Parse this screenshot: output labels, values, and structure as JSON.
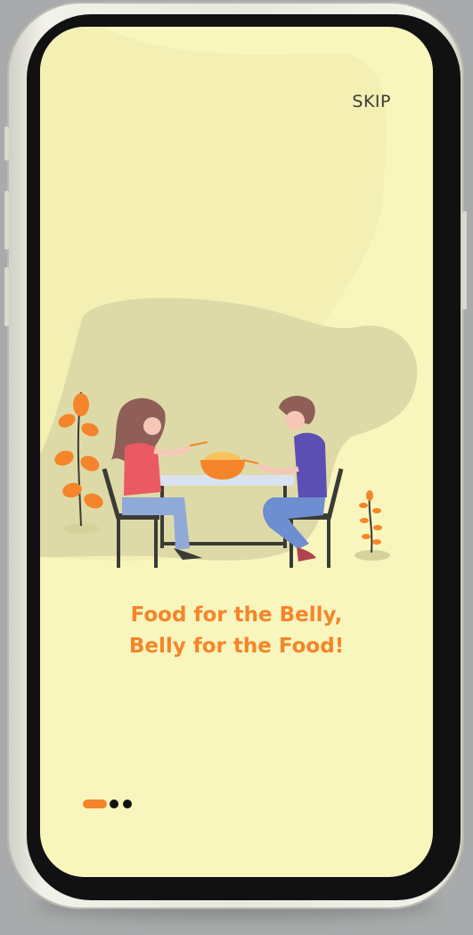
{
  "onboarding": {
    "skip_label": "SKIP",
    "tagline_line1": "Food for the Belly,",
    "tagline_line2": "Belly for the Food!",
    "illustration": "couple-dining-noodles-illustration",
    "page_indicator": {
      "total": 3,
      "current": 1
    }
  },
  "colors": {
    "background": "#f9f6bd",
    "accent": "#f5852a",
    "blob": "#dedaa8",
    "text_dark": "#3b3b36"
  }
}
